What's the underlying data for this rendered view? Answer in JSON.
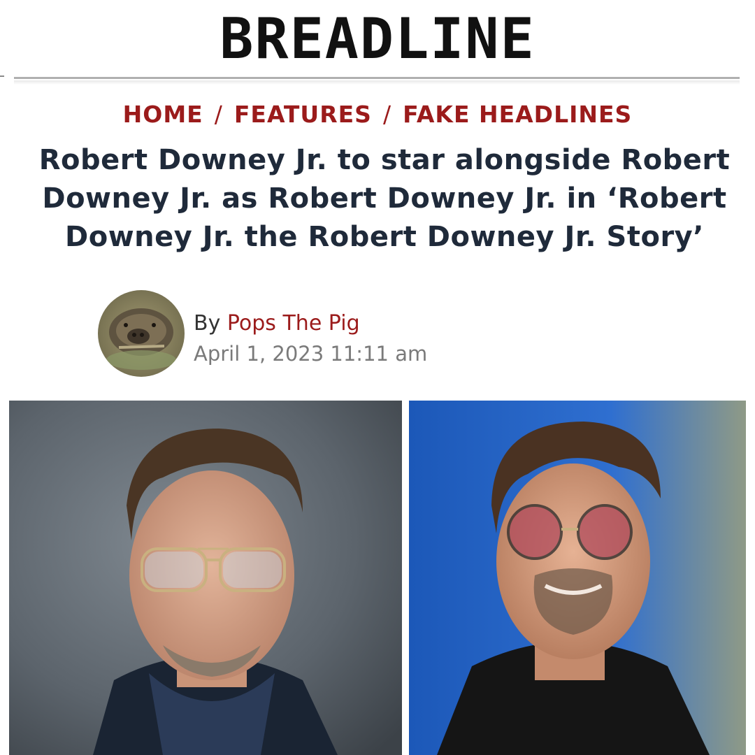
{
  "site": {
    "logo_text": "BREADLINE"
  },
  "breadcrumb": {
    "items": [
      {
        "label": "HOME"
      },
      {
        "label": "FEATURES"
      },
      {
        "label": "FAKE HEADLINES"
      }
    ],
    "separator": "/"
  },
  "article": {
    "headline": "Robert Downey Jr. to star alongside Robert Downey Jr. as Robert Downey Jr. in ‘Robert Downey Jr. the Robert Downey Jr. Story’",
    "byline_prefix": "By",
    "author": "Pops The Pig",
    "date": "April 1, 2023 11:11 am"
  },
  "colors": {
    "accent_red": "#9b1b1b",
    "headline_navy": "#1f2a3a",
    "date_gray": "#7a7a7a"
  }
}
